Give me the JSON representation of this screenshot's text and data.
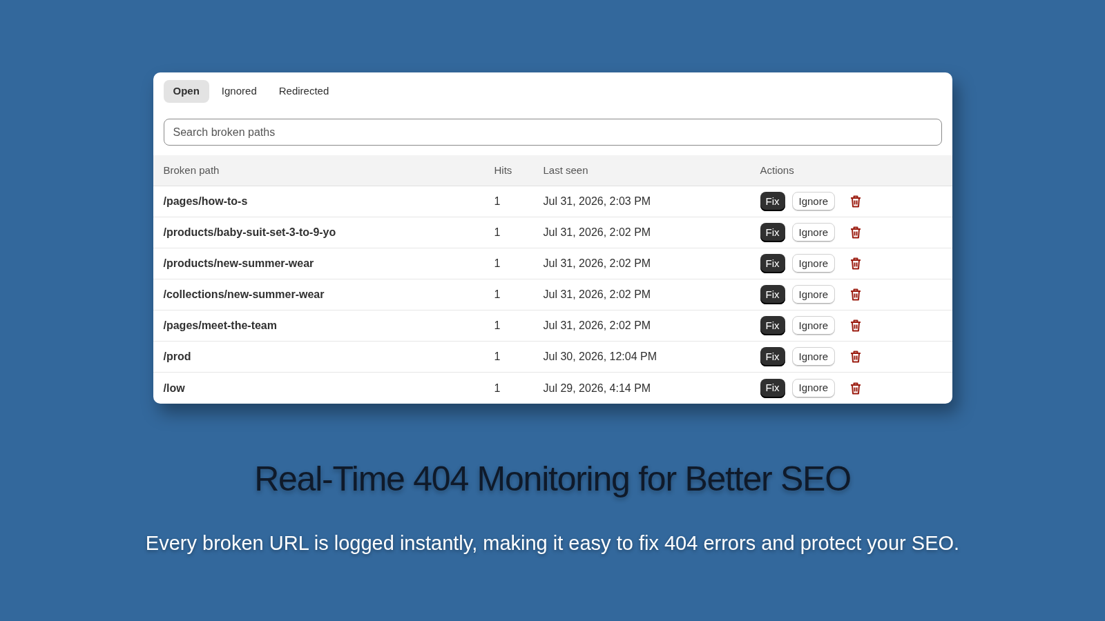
{
  "tabs": [
    {
      "label": "Open",
      "selected": true
    },
    {
      "label": "Ignored",
      "selected": false
    },
    {
      "label": "Redirected",
      "selected": false
    }
  ],
  "search": {
    "placeholder": "Search broken paths"
  },
  "table": {
    "columns": [
      "Broken path",
      "Hits",
      "Last seen",
      "Actions"
    ],
    "rows": [
      {
        "path": "/pages/how-to-s",
        "hits": "1",
        "last_seen": "Jul 31, 2026, 2:03 PM",
        "fix": "Fix",
        "ignore": "Ignore"
      },
      {
        "path": "/products/baby-suit-set-3-to-9-yo",
        "hits": "1",
        "last_seen": "Jul 31, 2026, 2:02 PM",
        "fix": "Fix",
        "ignore": "Ignore"
      },
      {
        "path": "/products/new-summer-wear",
        "hits": "1",
        "last_seen": "Jul 31, 2026, 2:02 PM",
        "fix": "Fix",
        "ignore": "Ignore"
      },
      {
        "path": "/collections/new-summer-wear",
        "hits": "1",
        "last_seen": "Jul 31, 2026, 2:02 PM",
        "fix": "Fix",
        "ignore": "Ignore"
      },
      {
        "path": "/pages/meet-the-team",
        "hits": "1",
        "last_seen": "Jul 31, 2026, 2:02 PM",
        "fix": "Fix",
        "ignore": "Ignore"
      },
      {
        "path": "/prod",
        "hits": "1",
        "last_seen": "Jul 30, 2026, 12:04 PM",
        "fix": "Fix",
        "ignore": "Ignore"
      },
      {
        "path": "/low",
        "hits": "1",
        "last_seen": "Jul 29, 2026, 4:14 PM",
        "fix": "Fix",
        "ignore": "Ignore"
      }
    ]
  },
  "headline": "Real-Time 404 Monitoring for Better SEO",
  "subheadline": "Every broken URL is logged instantly, making it easy to fix 404 errors and protect your SEO."
}
